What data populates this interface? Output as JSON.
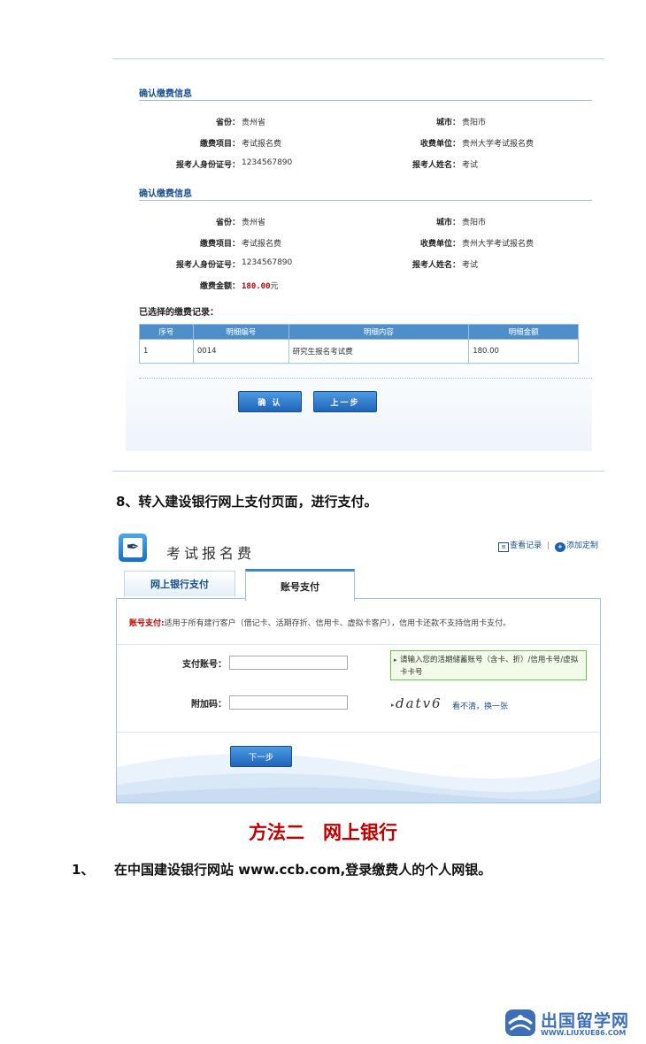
{
  "screenshot1": {
    "section1": {
      "title": "确认缴费信息",
      "province_label": "省份：",
      "province": "贵州省",
      "city_label": "城市：",
      "city": "贵阳市",
      "item_label": "缴费项目：",
      "item": "考试报名费",
      "payee_label": "收费单位：",
      "payee": "贵州大学考试报名费",
      "id_label": "报考人身份证号：",
      "id": "1234567890",
      "name_label": "报考人姓名：",
      "name": "考试"
    },
    "section2": {
      "title": "确认缴费信息",
      "province_label": "省份：",
      "province": "贵州省",
      "city_label": "城市：",
      "city": "贵阳市",
      "item_label": "缴费项目：",
      "item": "考试报名费",
      "payee_label": "收费单位：",
      "payee": "贵州大学考试报名费",
      "id_label": "报考人身份证号：",
      "id": "1234567890",
      "name_label": "报考人姓名：",
      "name": "考试",
      "amount_label": "缴费金额：",
      "amount": "180.00",
      "amount_unit": "元"
    },
    "records": {
      "title": "已选择的缴费记录：",
      "headers": [
        "序号",
        "明细编号",
        "明细内容",
        "明细金额"
      ],
      "rows": [
        [
          "1",
          "0014",
          "研究生报名考试费",
          "180.00"
        ]
      ]
    },
    "buttons": {
      "confirm": "确 认",
      "back": "上一步"
    }
  },
  "step8": "8、转入建设银行网上支付页面，进行支付。",
  "screenshot2": {
    "title": "考试报名费",
    "links": {
      "view_records": "查看记录",
      "separator": "|",
      "add_custom": "添加定制"
    },
    "tabs": {
      "online_bank": "网上银行支付",
      "account": "账号支付"
    },
    "note_label": "账号支付:",
    "note_text": "适用于所有建行客户（借记卡、活期存折、信用卡、虚拟卡客户），信用卡还款不支持信用卡支付。",
    "account_label": "支付账号：",
    "extra_label": "附加码：",
    "tip": "请输入您的活期储蓄账号（含卡、折）/信用卡号/虚拟卡卡号",
    "captcha": "datv6",
    "refresh": "看不清，换一张",
    "next": "下一步"
  },
  "method2": "方法二　网上银行",
  "step1": {
    "num": "1、",
    "text": "在中国建设银行网站 www.ccb.com,登录缴费人的个人网银。"
  },
  "watermark": {
    "text": "出国留学网",
    "url": "WWW.LIUXUE86.COM"
  },
  "colors": {
    "accent_blue": "#1a4f8f",
    "button_blue": "#1f64b9",
    "red": "#c00000",
    "tip_green": "#6fbf4a"
  }
}
